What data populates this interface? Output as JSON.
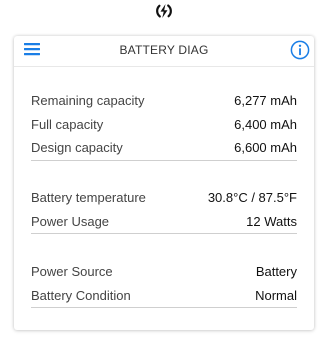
{
  "app": {
    "title": "BATTERY DIAG"
  },
  "header": {
    "menu_icon": "hamburger-menu-icon",
    "info_icon": "info-circle-icon",
    "top_icon": "charging-bolt-icon",
    "accent_color": "#1a7ee6"
  },
  "capacity": {
    "rows": [
      {
        "label": "Remaining capacity",
        "value": "6,277 mAh"
      },
      {
        "label": "Full capacity",
        "value": "6,400 mAh"
      },
      {
        "label": "Design capacity",
        "value": "6,600 mAh"
      }
    ]
  },
  "thermal": {
    "rows": [
      {
        "label": "Battery temperature",
        "value": "30.8°C / 87.5°F"
      },
      {
        "label": "Power Usage",
        "value": "12 Watts"
      }
    ]
  },
  "power": {
    "rows": [
      {
        "label": "Power Source",
        "value": "Battery"
      },
      {
        "label": "Battery Condition",
        "value": "Normal"
      }
    ]
  }
}
